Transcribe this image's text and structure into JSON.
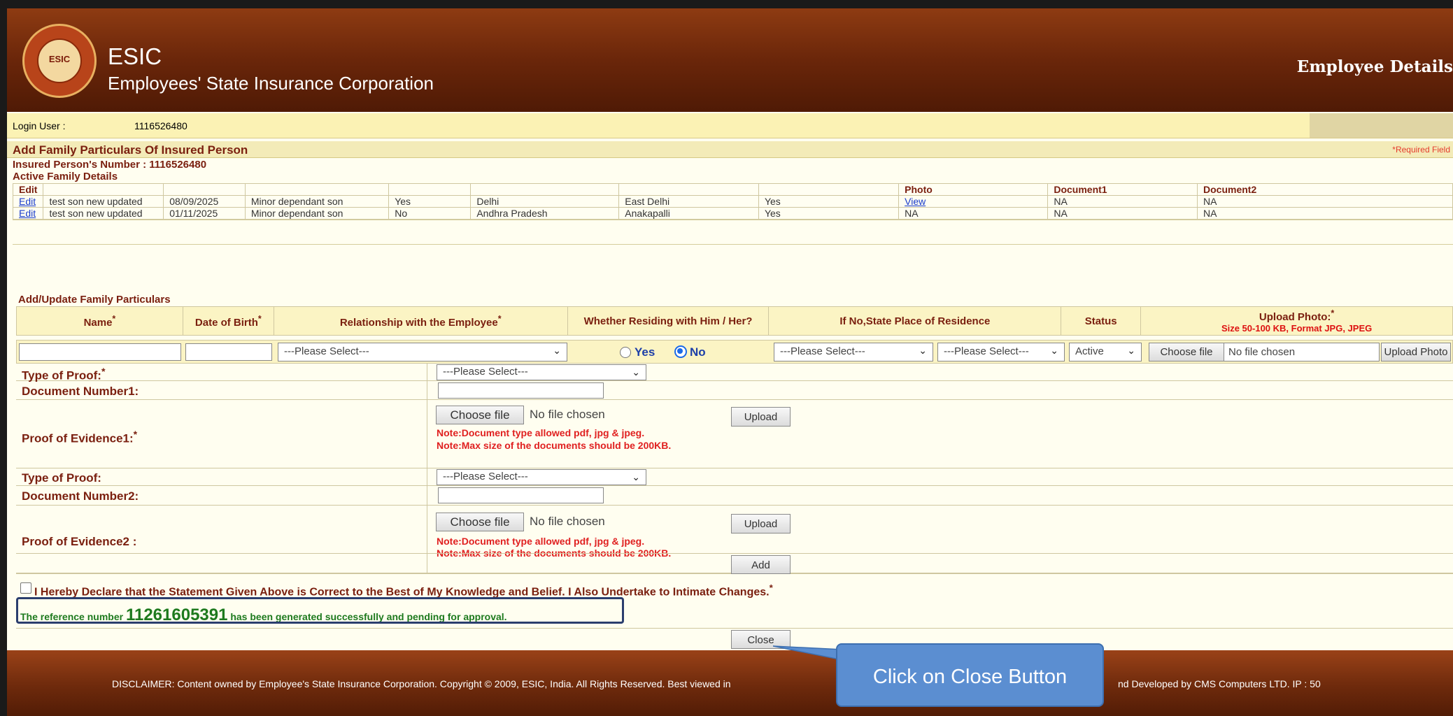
{
  "header": {
    "brand_short": "ESIC",
    "brand_long": "Employees' State Insurance Corporation",
    "page_title": "Employee Details",
    "logo_text": "ESIC"
  },
  "login": {
    "label": "Login User :",
    "value": "1116526480"
  },
  "section": {
    "title": "Add Family Particulars Of Insured Person",
    "required_note": "*Required Field",
    "ip_number": "Insured Person's Number :  1116526480",
    "active_family_title": "Active Family Details"
  },
  "family_table": {
    "headers": [
      "Edit",
      "",
      "",
      "",
      "",
      "",
      "",
      "",
      "Photo",
      "Document1",
      "Document2"
    ],
    "rows": [
      [
        "Edit",
        "test son new updated",
        "08/09/2025",
        "Minor dependant son",
        "Yes",
        "Delhi",
        "East Delhi",
        "Yes",
        "View",
        "NA",
        "NA"
      ],
      [
        "Edit",
        "test son new updated",
        "01/11/2025",
        "Minor dependant son",
        "No",
        "Andhra Pradesh",
        "Anakapalli",
        "Yes",
        "NA",
        "NA",
        "NA"
      ]
    ]
  },
  "add_update": {
    "title": "Add/Update Family Particulars",
    "headers": {
      "name": "Name",
      "dob": "Date of Birth",
      "relationship": "Relationship with the Employee",
      "residing": "Whether Residing with Him / Her?",
      "state_place": "If No,State Place of Residence",
      "status": "Status",
      "upload_photo": "Upload Photo:",
      "upload_photo_sub": "Size 50-100 KB, Format JPG, JPEG"
    },
    "inputs": {
      "name_value": "",
      "dob_value": "",
      "relationship_select": "---Please Select---",
      "radio_yes": "Yes",
      "radio_no": "No",
      "residing_selected": "No",
      "state_select": "---Please Select---",
      "district_select": "---Please Select---",
      "status_select": "Active",
      "choose_file": "Choose file",
      "no_file": "No file chosen",
      "upload_photo_btn": "Upload Photo"
    }
  },
  "proof": {
    "type1_label": "Type of Proof:",
    "type1_select": "---Please Select---",
    "docnum1_label": "Document Number1:",
    "evidence1_label": "Proof of Evidence1:",
    "type2_label": "Type of Proof:",
    "type2_select": "---Please Select---",
    "docnum2_label": "Document Number2:",
    "evidence2_label": "Proof of Evidence2 :",
    "choose_file": "Choose file",
    "no_file": "No file chosen",
    "upload_btn": "Upload",
    "note_type": "Note:Document type allowed pdf, jpg & jpeg.",
    "note_size": "Note:Max size of the documents should be 200KB.",
    "add_btn": "Add"
  },
  "declaration": "I Hereby Declare that the Statement Given Above is Correct to the Best of My Knowledge and Belief. I Also Undertake to Intimate Changes.",
  "success": {
    "prefix": "The reference number",
    "reference": "11261605391",
    "suffix": "has been generated successfully and pending for approval."
  },
  "close_btn": "Close",
  "footer": {
    "disclaimer_left": "DISCLAIMER: Content owned by Employee's State Insurance Corporation. Copyright © 2009, ESIC, India. All Rights Reserved. Best viewed in",
    "disclaimer_right": "nd Developed by CMS Computers LTD. IP : 50"
  },
  "callout": {
    "text": "Click on Close Button"
  }
}
